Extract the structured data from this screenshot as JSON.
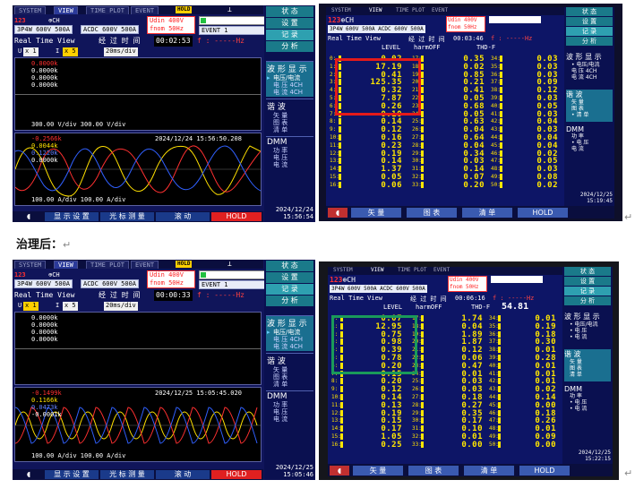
{
  "document": {
    "after_heading": "治理后："
  },
  "before": {
    "waveform": {
      "tabs": [
        "SYSTEM",
        "VIEW",
        "TIME PLOT",
        "EVENT"
      ],
      "hold_tag": "HOLD",
      "channel": "123",
      "ch_label": "CH",
      "wiring": "3P4W",
      "voltage_range": "600V",
      "current_range": "500A",
      "acdc": "ACDC",
      "acdc_v": "600V",
      "acdc_a": "500A",
      "udin": "Udin 400V",
      "freq": "fnom  50Hz",
      "event_tag": "EVENT",
      "event_val": "1",
      "title": "Real Time View",
      "elapsed_label": "经 过 时 间",
      "elapsed": "00:02:53",
      "f_label": "f :",
      "f_value": "-----Hz",
      "u_label": "U",
      "u_scale": "x 1",
      "i_label": "I",
      "i_scale": "x 5",
      "time_div": "20ms/div",
      "upper_values": [
        "0.0000k",
        "0.0000k",
        "0.0000k",
        "0.0000k"
      ],
      "upper_scale": "300.00 V/div    300.00 V/div",
      "lower_values": [
        "-0.2566k",
        "0.0044k",
        "0.1220k",
        "0.0000k"
      ],
      "lower_timestamp": "2024/12/24  15:56:50.208",
      "lower_scale": "100.00 A/div    100.00 A/div",
      "side_buttons": [
        "状 态",
        "设 置",
        "记 录",
        "分 析"
      ],
      "menu_wave": {
        "head": "波 形 显 示",
        "items": [
          "电压/电流",
          "电 压  4CH",
          "电 流  4CH"
        ]
      },
      "menu_harm": {
        "head": "谐 波",
        "items": [
          "矢 量",
          "图 表",
          "清 单"
        ]
      },
      "menu_dmm": {
        "head": "DMM",
        "items": [
          "功 率",
          "电 压",
          "电 流"
        ]
      },
      "footer": [
        "显 示 设 置",
        "光 标 测 量",
        "滚  动",
        "HOLD"
      ],
      "datetime": [
        "2024/12/24",
        "15:56:54"
      ]
    },
    "harmonics": {
      "tabs": [
        "SYSTEM",
        "VIEW",
        "TIME PLOT",
        "EVENT"
      ],
      "wiring": "3P4W 600V 500A ACDC 600V 500A",
      "udin": "Udin 400V",
      "freq": "fnom 50Hz",
      "title": "Real Time View",
      "elapsed_label": "经 过 时 间",
      "elapsed": "00:03:46",
      "f_label": "f :",
      "f_value": "-----Hz",
      "level_label": "LEVEL",
      "harm_label": "harmOFF",
      "thd_label": "THD-F",
      "thd_value": "",
      "col1_orders": [
        "0:",
        "1:",
        "2:",
        "3:",
        "4:",
        "5:",
        "6:",
        "7:",
        "8:",
        "9:",
        "10:",
        "11:",
        "12:",
        "13:",
        "14:",
        "15:",
        "16:"
      ],
      "col1": [
        "0.02",
        "17.19",
        "0.41",
        "125.35",
        "0.32",
        "7.87",
        "0.26",
        "0.10",
        "0.14",
        "0.12",
        "0.16",
        "0.23",
        "0.19",
        "0.14",
        "1.37",
        "0.05",
        "0.06"
      ],
      "col2_orders": [
        "17:",
        "18:",
        "19:",
        "20:",
        "21:",
        "22:",
        "23:",
        "24:",
        "25:",
        "26:",
        "27:",
        "28:",
        "29:",
        "30:",
        "31:",
        "32:",
        "33:"
      ],
      "col2": [
        "0.35",
        "0.02",
        "0.85",
        "0.21",
        "0.41",
        "0.05",
        "0.68",
        "0.05",
        "0.63",
        "0.04",
        "0.64",
        "0.04",
        "0.34",
        "0.03",
        "0.14",
        "0.07",
        "0.20"
      ],
      "col3_orders": [
        "34:",
        "35:",
        "36:",
        "37:",
        "38:",
        "39:",
        "40:",
        "41:",
        "42:",
        "43:",
        "44:",
        "45:",
        "46:",
        "47:",
        "48:",
        "49:",
        "50:"
      ],
      "col3": [
        "0.03",
        "0.03",
        "0.03",
        "0.09",
        "0.12",
        "0.03",
        "0.05",
        "0.03",
        "0.04",
        "0.03",
        "0.04",
        "0.04",
        "0.02",
        "0.05",
        "0.03",
        "0.08",
        "0.02"
      ],
      "side_buttons": [
        "状 态",
        "设 置",
        "记 录",
        "分 析"
      ],
      "menu_wave": {
        "head": "波 形 显 示",
        "items": [
          "• 电压/电流",
          "电 压 4CH",
          "电 流 4CH"
        ]
      },
      "menu_harm": {
        "head": "谐 波",
        "items": [
          "矢 量",
          "图 表",
          "• 清 单"
        ]
      },
      "menu_dmm": {
        "head": "DMM",
        "items": [
          "功 率",
          "• 电 压",
          "电 流"
        ]
      },
      "footer": [
        "矢 量",
        "图 表",
        "清 单",
        "HOLD"
      ],
      "datetime": [
        "2024/12/25",
        "15:19:45"
      ]
    }
  },
  "after": {
    "waveform": {
      "tabs": [
        "SYSTEM",
        "VIEW",
        "TIME PLOT",
        "EVENT"
      ],
      "hold_tag": "HOLD",
      "channel": "123",
      "ch_label": "CH",
      "wiring": "3P4W",
      "voltage_range": "600V",
      "current_range": "500A",
      "acdc": "ACDC",
      "acdc_v": "600V",
      "acdc_a": "500A",
      "udin": "Udin 400V",
      "freq": "fnom  50Hz",
      "event_tag": "EVENT",
      "event_val": "1",
      "title": "Real Time View",
      "elapsed_label": "经 过 时 间",
      "elapsed": "00:00:33",
      "f_label": "f :",
      "f_value": "-----Hz",
      "u_label": "U",
      "u_scale": "x 1",
      "i_label": "I",
      "i_scale": "x 5",
      "time_div": "20ms/div",
      "upper_values": [
        "0.0000k",
        "0.0000k",
        "0.0000k",
        "0.0000k"
      ],
      "upper_scale": "",
      "lower_values": [
        "-0.1499k",
        "0.1166k",
        "0.0473k",
        "-0.0001k"
      ],
      "lower_timestamp": "2024/12/25  15:05:45.020",
      "lower_scale": "100.00 A/div    100.00 A/div",
      "side_buttons": [
        "状 态",
        "设 置",
        "记 录",
        "分 析"
      ],
      "menu_wave": {
        "head": "波 形 显 示",
        "items": [
          "电压/电流",
          "电 压  4CH",
          "电 流  4CH"
        ]
      },
      "menu_harm": {
        "head": "谐 波",
        "items": [
          "矢 量",
          "图 表",
          "清 单"
        ]
      },
      "menu_dmm": {
        "head": "DMM",
        "items": [
          "功 率",
          "电 压",
          "电 流"
        ]
      },
      "footer": [
        "显 示 设 置",
        "光 标 测 量",
        "滚  动",
        "HOLD"
      ],
      "datetime": [
        "2024/12/25",
        "15:05:46"
      ]
    },
    "harmonics": {
      "tabs": [
        "SYSTEM",
        "VIEW",
        "TIME PLOT",
        "EVENT"
      ],
      "wiring": "3P4W 600V 500A ACDC 600V 500A",
      "udin": "Udin 400V",
      "freq": "fnom 50Hz",
      "title": "Real Time View",
      "elapsed_label": "经 过 时 间",
      "elapsed": "00:06:16",
      "f_label": "f :",
      "f_value": "-----Hz",
      "level_label": "LEVEL",
      "harm_label": "harmOFF",
      "thd_label": "THD-F",
      "thd_value": "54.81",
      "col1_orders": [
        "0:",
        "1:",
        "2:",
        "3:",
        "4:",
        "5:",
        "6:",
        "7:",
        "8:",
        "9:",
        "10:",
        "11:",
        "12:",
        "13:",
        "14:",
        "15:",
        "16:"
      ],
      "col1": [
        "0.07",
        "12.95",
        "0.75",
        "0.98",
        "0.39",
        "0.78",
        "0.20",
        "0.15",
        "0.20",
        "0.12",
        "0.14",
        "0.13",
        "0.19",
        "0.15",
        "0.17",
        "1.05",
        "0.25"
      ],
      "col2_orders": [
        "17:",
        "18:",
        "19:",
        "20:",
        "21:",
        "22:",
        "23:",
        "24:",
        "25:",
        "26:",
        "27:",
        "28:",
        "29:",
        "30:",
        "31:",
        "32:",
        "33:"
      ],
      "col2": [
        "1.74",
        "0.04",
        "1.89",
        "1.87",
        "0.12",
        "0.06",
        "0.47",
        "0.01",
        "0.03",
        "0.03",
        "0.18",
        "0.27",
        "0.35",
        "0.17",
        "0.10",
        "0.01",
        "0.00"
      ],
      "col3_orders": [
        "34:",
        "35:",
        "36:",
        "37:",
        "38:",
        "39:",
        "40:",
        "41:",
        "42:",
        "43:",
        "44:",
        "45:",
        "46:",
        "47:",
        "48:",
        "49:",
        "50:"
      ],
      "col3": [
        "0.01",
        "0.19",
        "0.18",
        "0.30",
        "0.01",
        "0.28",
        "0.01",
        "0.01",
        "0.01",
        "0.02",
        "0.14",
        "0.00",
        "0.18",
        "0.26",
        "0.01",
        "0.09",
        "0.00"
      ],
      "side_buttons": [
        "状 态",
        "设 置",
        "记 录",
        "分 析"
      ],
      "menu_wave": {
        "head": "波 形 显 示",
        "items": [
          "• 电压/电流",
          "• 电 压",
          "• 电 流"
        ]
      },
      "menu_harm": {
        "head": "谐 波",
        "items": [
          "矢 量",
          "图 表",
          "清 单"
        ]
      },
      "menu_dmm": {
        "head": "DMM",
        "items": [
          "功 率",
          "• 电 压",
          "• 电 流"
        ]
      },
      "footer": [
        "矢 量",
        "图 表",
        "清 单",
        "HOLD"
      ],
      "datetime": [
        "2024/12/25",
        "15:22:15"
      ]
    }
  }
}
